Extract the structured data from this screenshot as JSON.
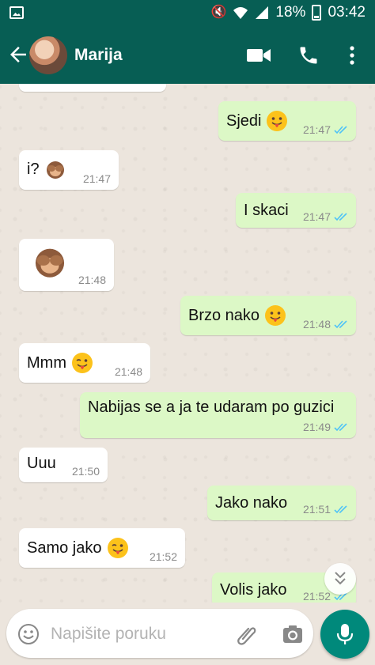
{
  "status_bar": {
    "battery": "18%",
    "time": "03:42",
    "icons": [
      "gallery-notification-icon",
      "mute-vibrate-icon",
      "wifi-icon",
      "signal-icon",
      "battery-icon"
    ]
  },
  "header": {
    "contact_name": "Marija",
    "icons": [
      "back-arrow-icon",
      "video-call-icon",
      "phone-icon",
      "more-vert-icon"
    ]
  },
  "messages": [
    {
      "direction": "out",
      "text": "Sjedi",
      "emoji": "tongue-face",
      "time": "21:47",
      "read": true
    },
    {
      "direction": "in",
      "text": "i?",
      "emoji": "see-no-evil-monkey",
      "time": "21:47"
    },
    {
      "direction": "out",
      "text": "I skaci",
      "time": "21:47",
      "read": true
    },
    {
      "direction": "in",
      "text": "",
      "emoji": "see-no-evil-monkey",
      "time": "21:48"
    },
    {
      "direction": "out",
      "text": "Brzo nako",
      "emoji": "tongue-face",
      "time": "21:48",
      "read": true
    },
    {
      "direction": "in",
      "text": "Mmm",
      "emoji": "winking-tongue-face",
      "time": "21:48"
    },
    {
      "direction": "out",
      "text": "Nabijas se a ja te udaram po guzici",
      "time": "21:49",
      "read": true
    },
    {
      "direction": "in",
      "text": "Uuu",
      "time": "21:50"
    },
    {
      "direction": "out",
      "text": "Jako nako",
      "time": "21:51",
      "read": true
    },
    {
      "direction": "in",
      "text": "Samo jako",
      "emoji": "winking-tongue-face",
      "time": "21:52"
    },
    {
      "direction": "out",
      "text": "Volis jako",
      "time": "21:52",
      "read": true
    }
  ],
  "composer": {
    "placeholder": "Napišite poruku"
  },
  "colors": {
    "header": "#075e54",
    "outgoing_bubble": "#dcf8c6",
    "incoming_bubble": "#ffffff",
    "read_ticks": "#4fc3f7",
    "mic_button": "#00897b"
  }
}
